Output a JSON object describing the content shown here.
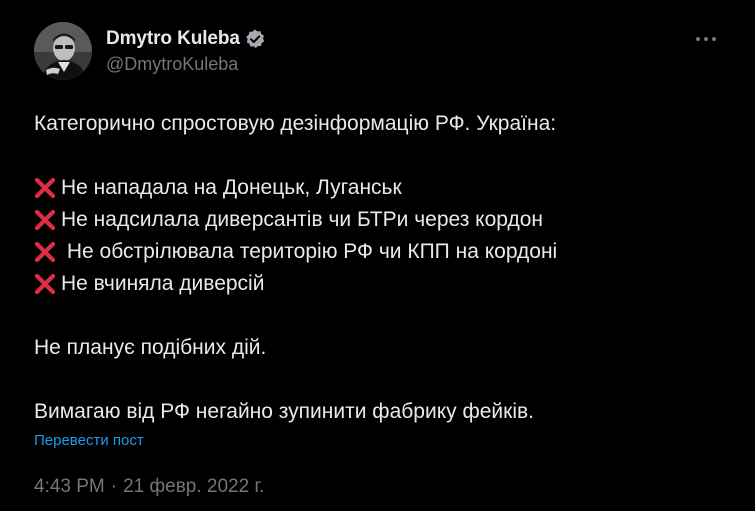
{
  "author": {
    "display_name": "Dmytro Kuleba",
    "handle": "@DmytroKuleba",
    "verified_icon": "verified-badge-icon",
    "avatar_icon": "avatar-photo"
  },
  "tweet": {
    "intro": "Категорично спростовую дезінформацію РФ. Україна:",
    "denials": [
      "Не нападала на Донецьк, Луганськ",
      "Не надсилала диверсантів чи БТРи через кордон",
      " Не обстрілювала територію РФ чи КПП на кордоні",
      "Не вчиняла диверсій"
    ],
    "denial_icon": "red-cross-mark-icon",
    "statement": "Не планує подібних дій.",
    "demand": "Вимагаю від РФ негайно зупинити фабрику фейків.",
    "translate_label": "Перевести пост",
    "time": "4:43 PM",
    "separator": "·",
    "date": "21 февр. 2022 г."
  },
  "colors": {
    "background": "#000000",
    "text": "#e7e9ea",
    "secondary": "#71767b",
    "link": "#1d9bf0",
    "cross": "#dd2e44"
  }
}
